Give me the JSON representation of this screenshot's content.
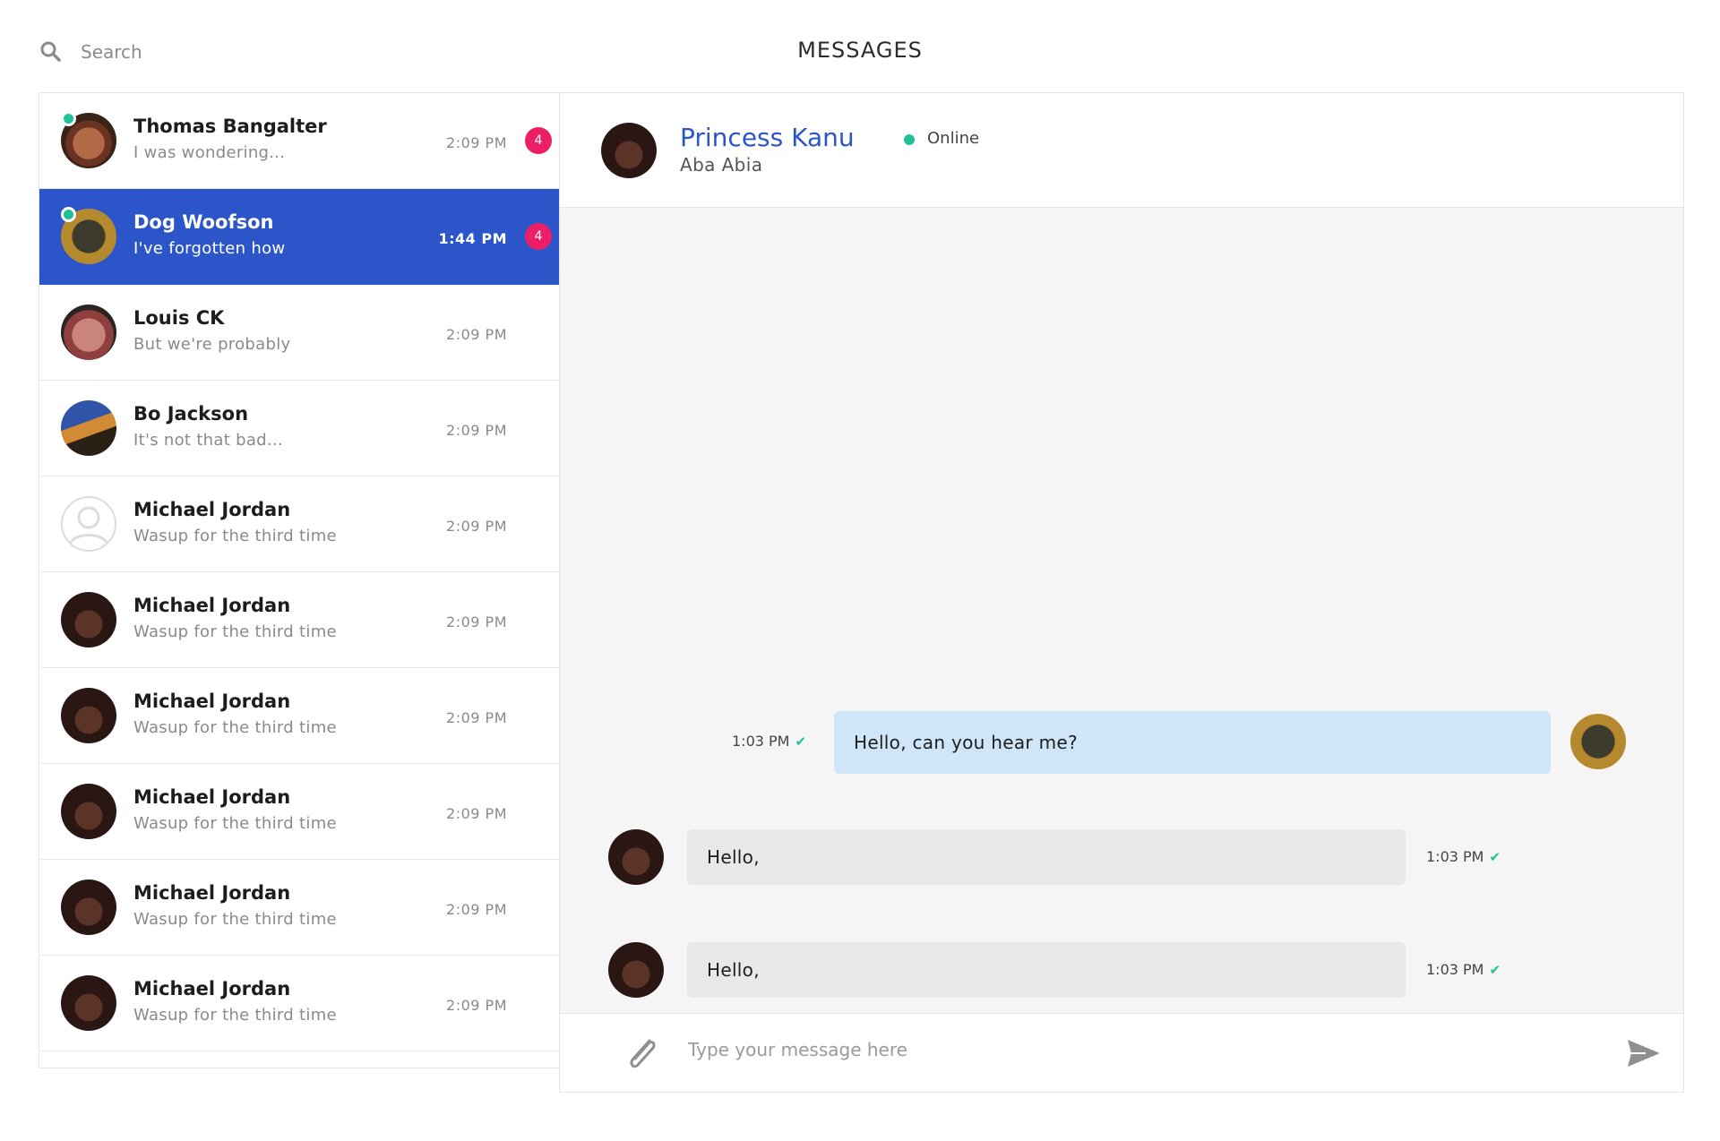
{
  "search": {
    "placeholder": "Search",
    "icon": "search-icon"
  },
  "header": {
    "title": "MESSAGES"
  },
  "colors": {
    "accent": "#2b55c8",
    "online": "#21c197",
    "badge": "#ec1f66",
    "outgoing_bubble": "#cfe6f8",
    "incoming_bubble": "#e8e8e8"
  },
  "conversations": [
    {
      "name": "Thomas Bangalter",
      "preview": "I was wondering...",
      "time": "2:09 PM",
      "badge": "4",
      "online": true
    },
    {
      "name": "Dog Woofson",
      "preview": "I've forgotten how",
      "time": "1:44 PM",
      "badge": "4",
      "online": true,
      "active": true
    },
    {
      "name": "Louis CK",
      "preview": "But we're probably",
      "time": "2:09 PM"
    },
    {
      "name": "Bo Jackson",
      "preview": "It's not that bad...",
      "time": "2:09 PM"
    },
    {
      "name": "Michael Jordan",
      "preview": "Wasup for the third time",
      "time": "2:09 PM"
    },
    {
      "name": "Michael Jordan",
      "preview": "Wasup for the third time",
      "time": "2:09 PM"
    },
    {
      "name": "Michael Jordan",
      "preview": "Wasup for the third time",
      "time": "2:09 PM"
    },
    {
      "name": "Michael Jordan",
      "preview": "Wasup for the third time",
      "time": "2:09 PM"
    },
    {
      "name": "Michael Jordan",
      "preview": "Wasup for the third time",
      "time": "2:09 PM"
    },
    {
      "name": "Michael Jordan",
      "preview": "Wasup for the third time",
      "time": "2:09 PM"
    }
  ],
  "chat": {
    "contact_name": "Princess Kanu",
    "contact_subtitle": "Aba Abia",
    "status": "Online",
    "messages": [
      {
        "direction": "out",
        "text": "Hello, can you hear me?",
        "time": "1:03 PM",
        "status": "✔"
      },
      {
        "direction": "in",
        "text": "Hello,",
        "time": "1:03 PM",
        "status": "✔"
      },
      {
        "direction": "in",
        "text": "Hello,",
        "time": "1:03 PM",
        "status": "✔"
      }
    ],
    "composer": {
      "placeholder": "Type your message here",
      "attach_icon": "paperclip-icon",
      "send_icon": "send-icon"
    }
  }
}
